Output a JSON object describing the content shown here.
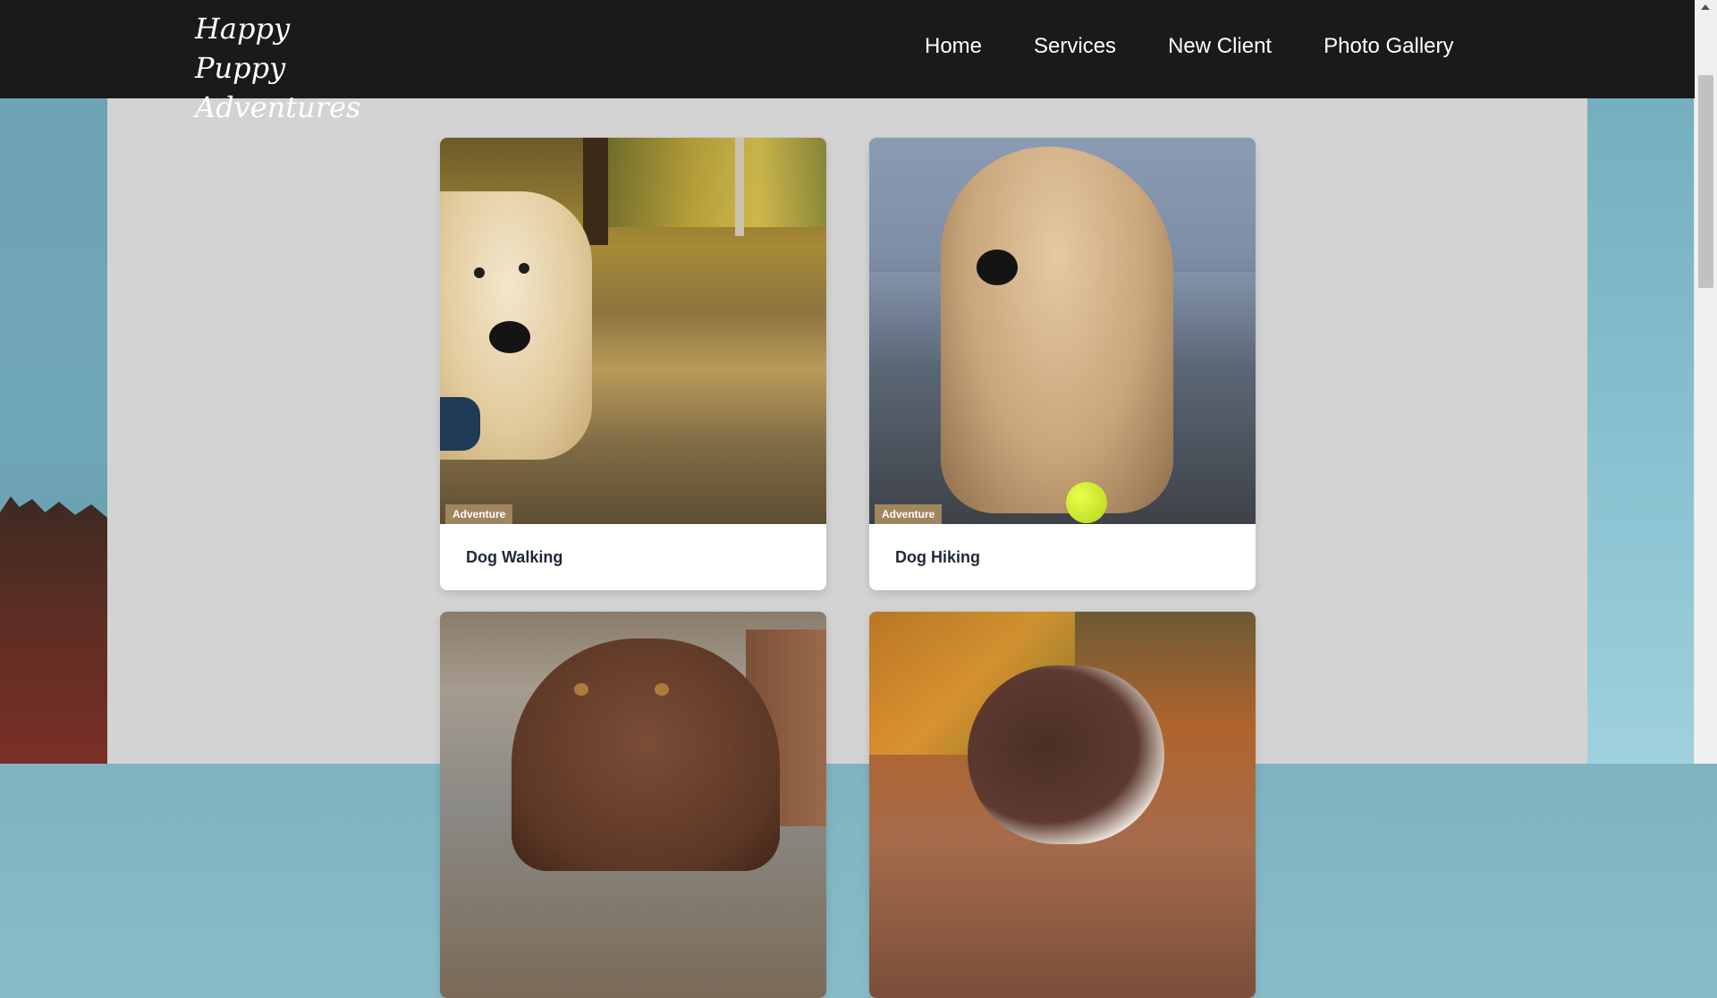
{
  "header": {
    "logo_line1": "Happy Puppy",
    "logo_line2": "Adventures",
    "nav": [
      "Home",
      "Services",
      "New Client",
      "Photo Gallery"
    ]
  },
  "cards": [
    {
      "badge": "Adventure",
      "title": "Dog Walking"
    },
    {
      "badge": "Adventure",
      "title": "Dog Hiking"
    },
    {
      "badge": "",
      "title": ""
    },
    {
      "badge": "",
      "title": ""
    }
  ],
  "colors": {
    "header_bg": "#1a1a1a",
    "panel_bg": "#d3d3d3",
    "badge_bg": "#a0855f",
    "card_title": "#1f2937"
  }
}
